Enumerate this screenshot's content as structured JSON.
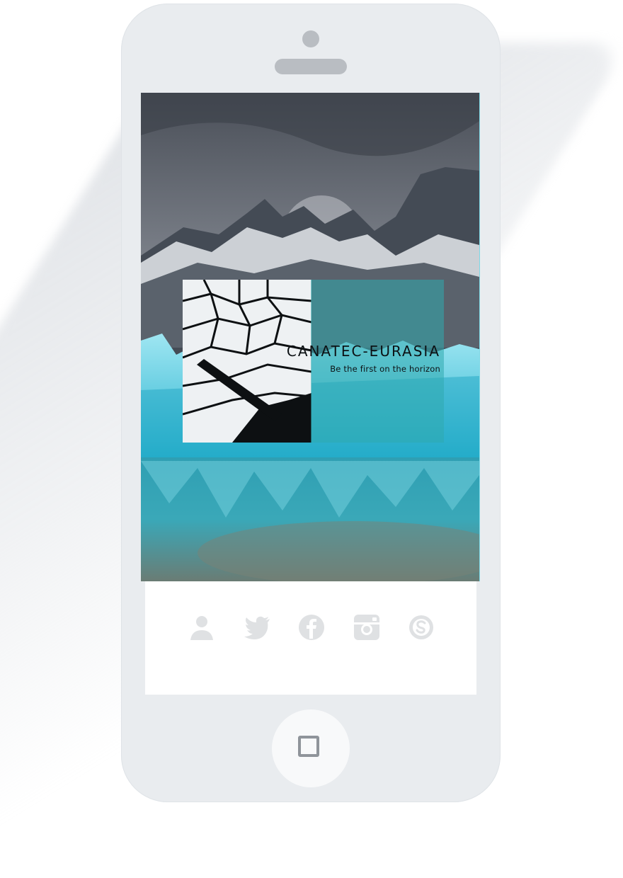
{
  "brand": {
    "title": "CANATEC-EURASIA",
    "tagline": "Be the first on the horizon"
  },
  "social_icons": [
    "user-icon",
    "twitter-icon",
    "facebook-icon",
    "instagram-icon",
    "skype-icon"
  ],
  "colors": {
    "phone_body": "#e9ecef",
    "icon_gray": "#dfe1e3",
    "teal_overlay": "#30aaaf",
    "ice_blue": "#3fc4d8"
  }
}
